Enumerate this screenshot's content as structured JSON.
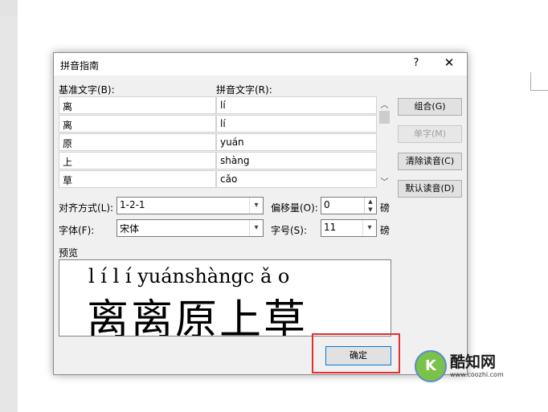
{
  "dialog": {
    "title": "拼音指南",
    "help": "?",
    "close": "✕",
    "base_label": "基准文字(B):",
    "ruby_label": "拼音文字(R):",
    "rows": [
      {
        "base": "离",
        "ruby": "lí"
      },
      {
        "base": "离",
        "ruby": "lí"
      },
      {
        "base": "原",
        "ruby": "yuán"
      },
      {
        "base": "上",
        "ruby": "shàng"
      },
      {
        "base": "草",
        "ruby": "cǎo"
      }
    ],
    "buttons": {
      "group": "组合(G)",
      "mono": "单字(M)",
      "clear": "清除读音(C)",
      "default": "默认读音(D)",
      "ok": "确定"
    },
    "alignment": {
      "label": "对齐方式(L):",
      "value": "1-2-1"
    },
    "offset": {
      "label": "偏移量(O):",
      "value": "0",
      "unit": "磅"
    },
    "font": {
      "label": "字体(F):",
      "value": "宋体"
    },
    "size": {
      "label": "字号(S):",
      "value": "11",
      "unit": "磅"
    },
    "preview": {
      "label": "预览",
      "pinyin": "l í l í yuánshàngc ǎ o",
      "text": "离离原上草"
    }
  },
  "watermark": {
    "name": "酷知网",
    "url": "www.coozhi.com"
  }
}
